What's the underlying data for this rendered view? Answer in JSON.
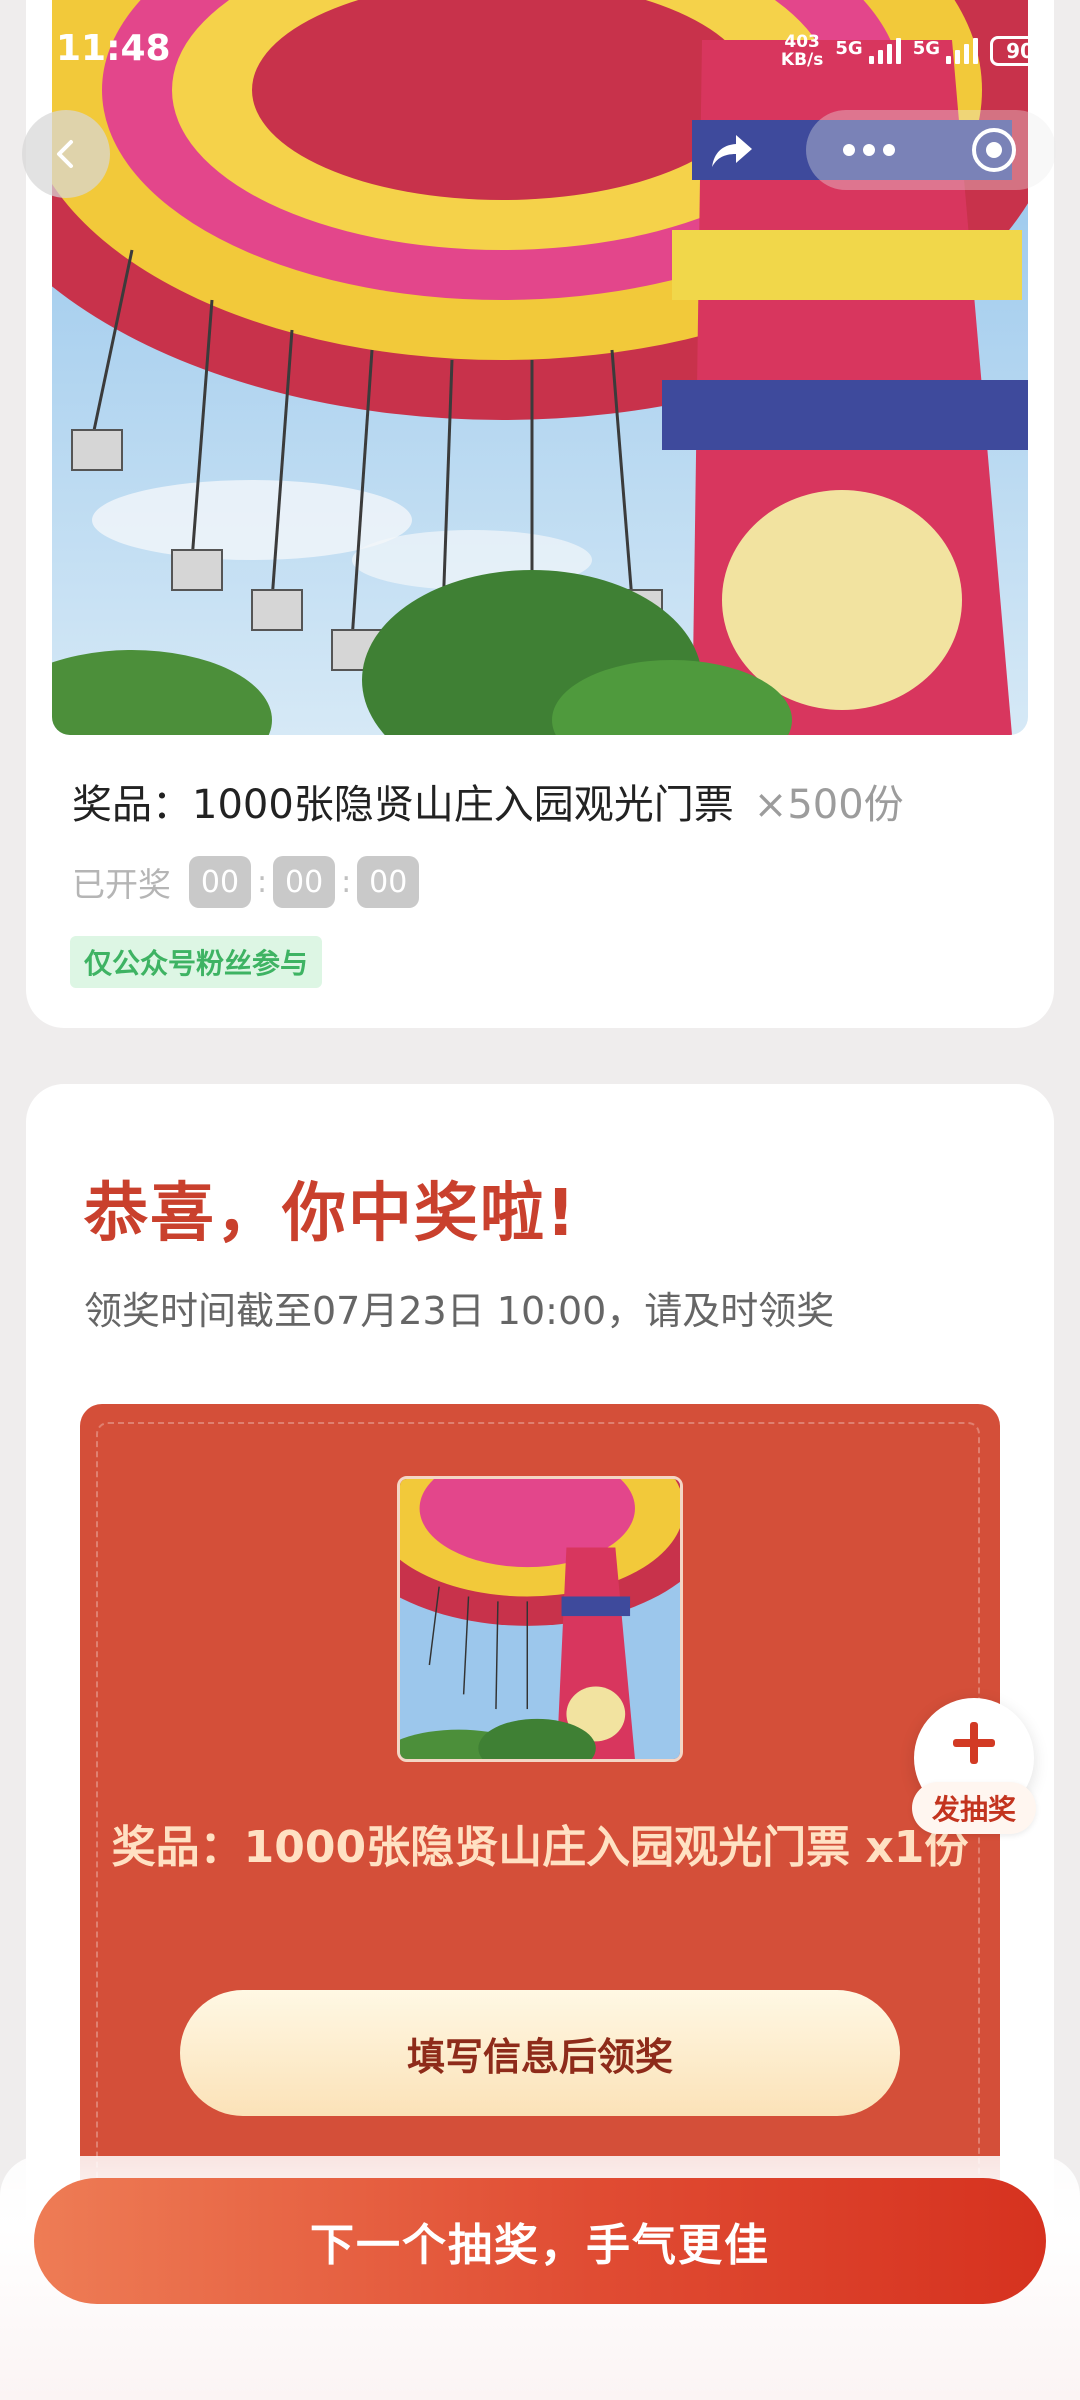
{
  "status_bar": {
    "time": "11:48",
    "net_speed_value": "403",
    "net_speed_unit": "KB/s",
    "sim1": "5G",
    "sim2": "5G",
    "battery": "90"
  },
  "nav": {
    "back_icon": "chevron-left-icon",
    "share_icon": "share-arrow-icon",
    "more_icon": "more-dots-icon",
    "close_icon": "target-circle-icon"
  },
  "lottery": {
    "prize_label": "奖品：1000张隐贤山庄入园观光门票",
    "prize_qty": "×500份",
    "status_label": "已开奖",
    "countdown": [
      "00",
      "00",
      "00"
    ],
    "countdown_sep": ":",
    "restriction_tag": "仅公众号粉丝参与"
  },
  "result": {
    "congrats_title": "恭喜，你中奖啦!",
    "deadline_text": "领奖时间截至07月23日 10:00，请及时领奖",
    "prize_text": "奖品：1000张隐贤山庄入园观光门票 x1份",
    "claim_button": "填写信息后领奖"
  },
  "fab": {
    "icon": "plus-icon",
    "label": "发抽奖"
  },
  "bottom": {
    "next_button": "下一个抽奖，手气更佳"
  },
  "colors": {
    "accent_red": "#d44f39",
    "title_red": "#c9402d",
    "tag_green": "#3eb363"
  }
}
